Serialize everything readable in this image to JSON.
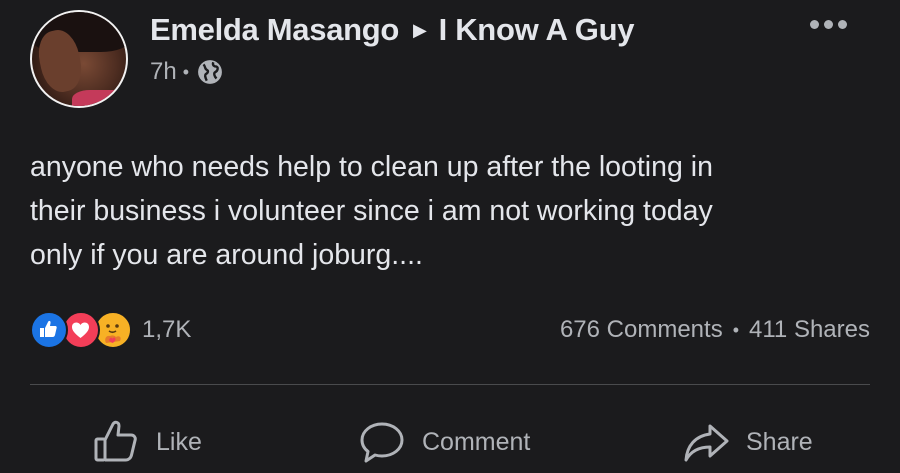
{
  "post": {
    "author": "Emelda Masango",
    "group": "I Know A Guy",
    "time": "7h",
    "privacy_icon": "globe-icon",
    "lines": [
      "anyone who needs help to clean up after the looting in",
      "their business i volunteer since i am not working today",
      "only if you are around joburg...."
    ]
  },
  "reactions": {
    "types": [
      "like",
      "love",
      "care"
    ],
    "count": "1,7K"
  },
  "stats": {
    "comments": "676 Comments",
    "separator": "•",
    "shares": "411 Shares"
  },
  "actions": {
    "like": "Like",
    "comment": "Comment",
    "share": "Share"
  },
  "colors": {
    "background": "#1b1b1d",
    "text": "#e4e6eb",
    "secondary": "#b0b3b8",
    "like": "#1b74e4",
    "love": "#f33e58",
    "care": "#f7b125"
  }
}
